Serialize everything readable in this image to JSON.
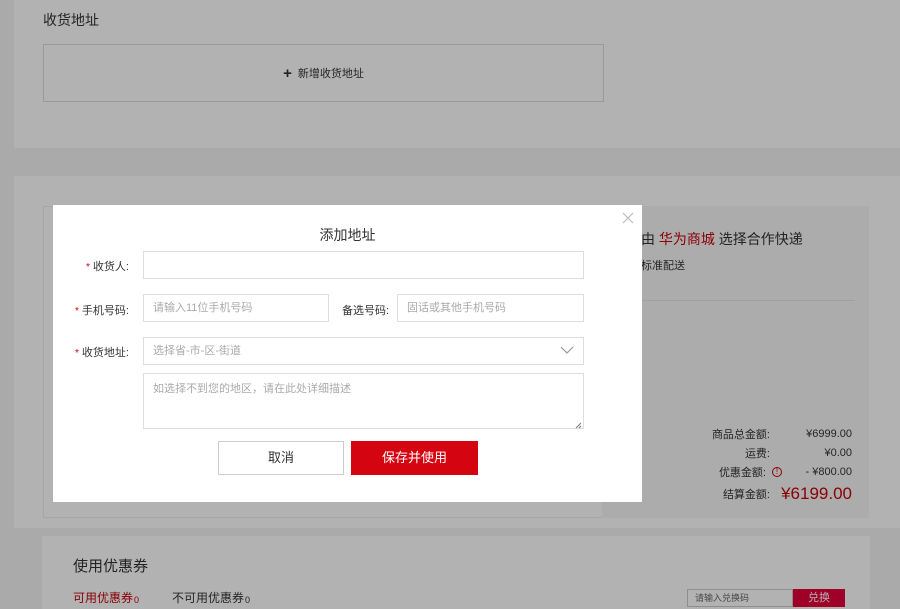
{
  "address_section": {
    "title": "收货地址",
    "add_label": "新增收货地址"
  },
  "shipping": {
    "title_prefix": "由",
    "brand": "华为商城",
    "title_suffix": "选择合作快递",
    "method": "标准配送"
  },
  "summary": {
    "goods_total_label": "商品总金额:",
    "goods_total_value": "¥6999.00",
    "freight_label": "运费:",
    "freight_value": "¥0.00",
    "discount_label": "优惠金额:",
    "discount_value": "- ¥800.00",
    "total_label": "结算金额:",
    "total_value": "¥6199.00"
  },
  "coupons": {
    "title": "使用优惠券",
    "available_tab": "可用优惠券",
    "available_count": "0",
    "unavailable_tab": "不可用优惠券",
    "unavailable_count": "0",
    "exchange_placeholder": "请输入兑换码",
    "exchange_button": "兑换"
  },
  "modal": {
    "title": "添加地址",
    "receiver_label": "收货人:",
    "receiver_value": "",
    "phone_label": "手机号码:",
    "phone_placeholder": "请输入11位手机号码",
    "alt_phone_label": "备选号码:",
    "alt_phone_placeholder": "固话或其他手机号码",
    "address_label": "收货地址:",
    "region_placeholder": "选择省-市-区-街道",
    "detail_placeholder": "如选择不到您的地区，请在此处详细描述",
    "cancel_button": "取消",
    "save_button": "保存并使用",
    "required_mark": "*"
  },
  "colors": {
    "accent": "#c7000b",
    "save_button": "#d50411",
    "exchange_button": "#e4003a"
  },
  "icons": {
    "plus": "plus-icon",
    "close": "close-icon",
    "chevron": "chevron-down-icon",
    "warning": "info-circle-icon"
  }
}
